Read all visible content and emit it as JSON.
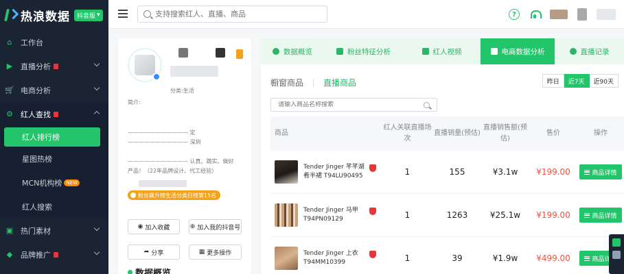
{
  "brand": {
    "name": "热浪数据",
    "badge": "抖音版"
  },
  "colors": {
    "accent": "#22c56a",
    "sidebar": "#1b2433",
    "price": "#f0503c",
    "badge_orange": "#f4a21a"
  },
  "nav": {
    "items": [
      {
        "label": "工作台",
        "icon": "home-icon"
      },
      {
        "label": "直播分析",
        "icon": "live-icon"
      },
      {
        "label": "电商分析",
        "icon": "cart-icon"
      },
      {
        "label": "红人查找",
        "icon": "user-search-icon"
      }
    ],
    "sub_items": [
      {
        "label": "红人排行榜"
      },
      {
        "label": "星图热榜"
      },
      {
        "label": "MCN机构榜",
        "badge": "NEW"
      },
      {
        "label": "红人搜索"
      }
    ],
    "tail_items": [
      {
        "label": "热门素材",
        "icon": "material-icon"
      },
      {
        "label": "品牌推广",
        "icon": "brand-icon"
      }
    ]
  },
  "header": {
    "search_placeholder": "支持搜索红人、直播、商品"
  },
  "profile": {
    "category": "分类:生活",
    "intro_label": "简介:",
    "intro_line_1": "——————————— 定",
    "intro_line_2": "——————————— 深圳",
    "intro_line_3": "——————————— 认真、踏实、做好",
    "intro_line_4": "产品！（22年品牌设计、代工经验）",
    "fan_badge": "粉丝飙升榜生活分类日榜第15名",
    "buttons": {
      "collect": "加入收藏",
      "add_douyin": "加入我的抖音号",
      "share": "分享",
      "more": "更多操作"
    },
    "section_title": "数据概览"
  },
  "tabs": [
    {
      "label": "数据概览"
    },
    {
      "label": "粉丝特征分析"
    },
    {
      "label": "红人视频"
    },
    {
      "label": "电商数据分析"
    },
    {
      "label": "直播记录"
    }
  ],
  "subtabs": {
    "window": "橱窗商品",
    "live": "直播商品"
  },
  "range": {
    "yesterday": "昨日",
    "d7": "近7天",
    "d90": "近90天"
  },
  "goods_search_placeholder": "请输入商品名称搜索",
  "table": {
    "headers": {
      "product": "商品",
      "sessions": "红人关联直播场次",
      "volume": "直播销量(预估)",
      "amount": "直播销售额(预估)",
      "price": "售价",
      "op": "操作"
    },
    "rows": [
      {
        "name": "Tender Jinger 芊芊湖肴半裙 T94LU90495",
        "sessions": "1",
        "volume": "155",
        "amount": "¥3.1w",
        "price": "¥199.00",
        "action": "商品详情"
      },
      {
        "name": "Tender Jinger 马甲 T94PN09129",
        "sessions": "1",
        "volume": "1263",
        "amount": "¥25.1w",
        "price": "¥199.00",
        "action": "商品详情"
      },
      {
        "name": "Tender Jinger 上衣 T94MM10399",
        "sessions": "1",
        "volume": "39",
        "amount": "¥1.9w",
        "price": "¥499.00",
        "action": "商品详情"
      }
    ]
  }
}
